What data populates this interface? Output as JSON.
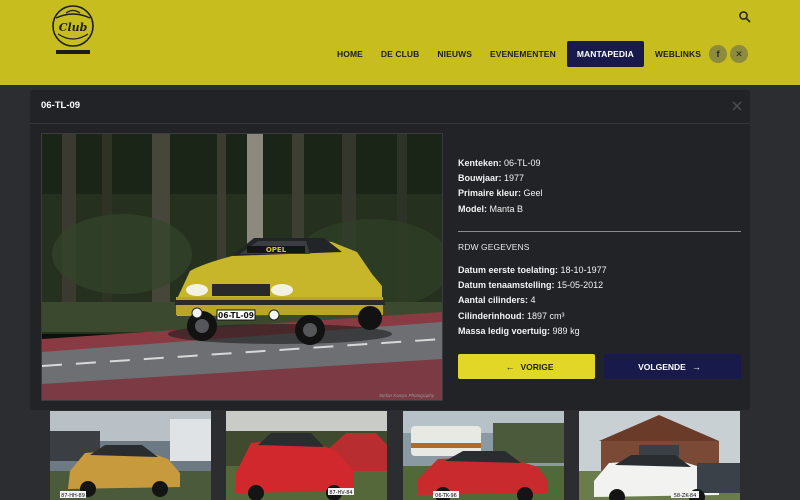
{
  "header": {
    "logo_text": "Manta Club Nederland",
    "nav": [
      {
        "label": "HOME",
        "active": false
      },
      {
        "label": "DE CLUB",
        "active": false
      },
      {
        "label": "NIEUWS",
        "active": false
      },
      {
        "label": "EVENEMENTEN",
        "active": false
      },
      {
        "label": "MANTAPEDIA",
        "active": true
      },
      {
        "label": "WEBLINKS",
        "active": false
      }
    ],
    "social": [
      {
        "icon": "facebook-icon",
        "glyph": "f"
      },
      {
        "icon": "x-twitter-icon",
        "glyph": "✕"
      }
    ],
    "search_icon": "search-icon"
  },
  "modal": {
    "title": "06-TL-09",
    "close_icon": "close-icon",
    "photo": {
      "plate": "06-TL-09",
      "hood_text": "OPEL",
      "credit": "Stefan Kamps Photography"
    },
    "details": [
      {
        "label": "Kenteken:",
        "value": "06-TL-09"
      },
      {
        "label": "Bouwjaar:",
        "value": "1977"
      },
      {
        "label": "Primaire kleur:",
        "value": "Geel"
      },
      {
        "label": "Model:",
        "value": "Manta B"
      }
    ],
    "rdw_heading": "RDW GEGEVENS",
    "rdw": [
      {
        "label": "Datum eerste toelating:",
        "value": "18-10-1977"
      },
      {
        "label": "Datum tenaamstelling:",
        "value": "15-05-2012"
      },
      {
        "label": "Aantal cilinders:",
        "value": "4"
      },
      {
        "label": "Cilinderinhoud:",
        "value": "1897 cm³"
      },
      {
        "label": "Massa ledig voertuig:",
        "value": "989 kg"
      }
    ],
    "prev_label": "VORIGE",
    "next_label": "VOLGENDE"
  },
  "thumbnails": [
    {
      "plate": "87-HH-89"
    },
    {
      "plate": "87-HV-84"
    },
    {
      "plate": "06-TK-96"
    },
    {
      "plate": "58-ZK-84"
    }
  ],
  "colors": {
    "header_bg": "#c7bd1f",
    "accent_navy": "#171a4a",
    "accent_yellow": "#e2d626",
    "modal_bg": "#212327",
    "page_bg": "#2b2d31"
  }
}
